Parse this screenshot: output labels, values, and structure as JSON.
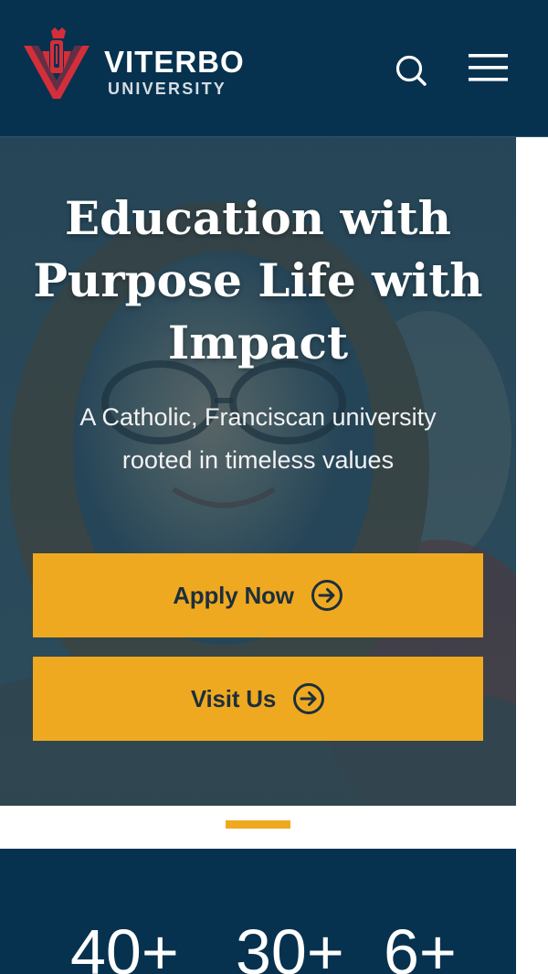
{
  "header": {
    "logo_line1": "VITERBO",
    "logo_line2": "UNIVERSITY",
    "search_icon": "search-icon",
    "menu_icon": "hamburger-menu-icon"
  },
  "hero": {
    "title": "Education with Purpose Life with Impact",
    "subtitle": "A Catholic, Franciscan university rooted in timeless values",
    "buttons": [
      {
        "label": "Apply Now",
        "icon": "arrow-right-circle-icon"
      },
      {
        "label": "Visit Us",
        "icon": "arrow-right-circle-icon"
      }
    ]
  },
  "stats": {
    "values": [
      "40+",
      "30+",
      "6+"
    ]
  },
  "colors": {
    "navy": "#06324f",
    "gold": "#efa920",
    "brand_red": "#d42e3b",
    "button_text": "#1d2f3c"
  }
}
